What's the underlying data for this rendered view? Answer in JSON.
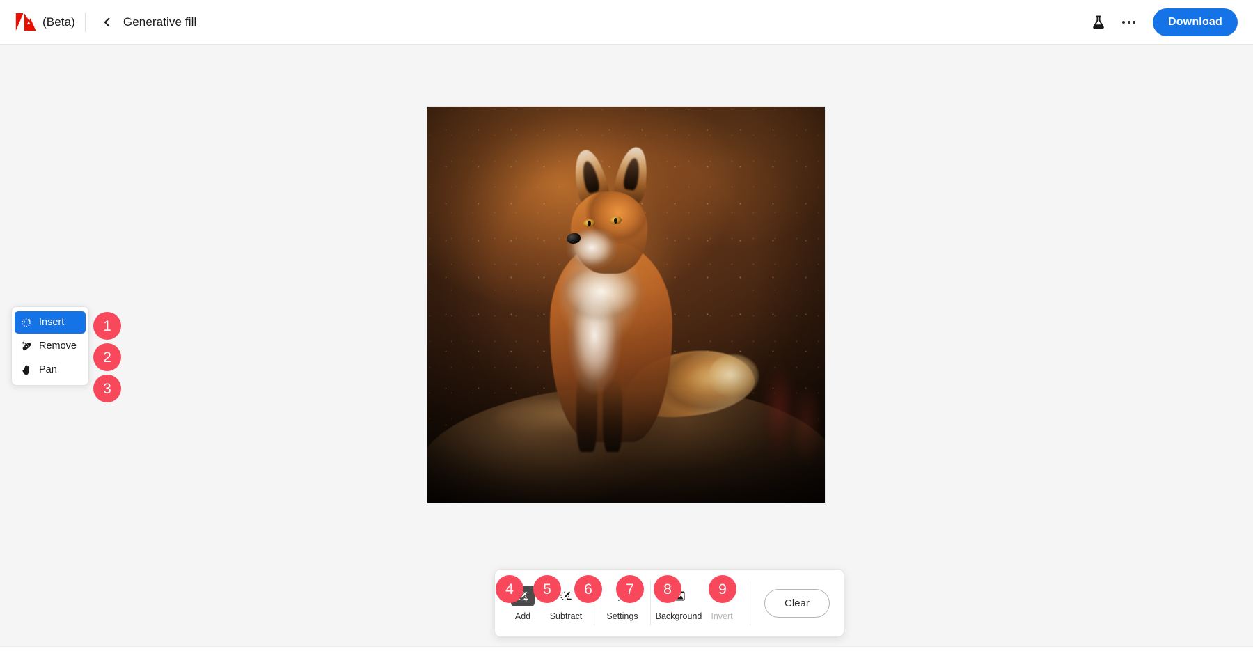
{
  "app": {
    "brand_logo": "adobe-logo",
    "beta_label": "(Beta)",
    "page_title": "Generative fill"
  },
  "header": {
    "back_icon": "chevron-left-icon",
    "experiments_icon": "flask-icon",
    "more_icon": "more-options-icon",
    "download_label": "Download",
    "accent_color": "#1473e6"
  },
  "tool_panel": {
    "items": [
      {
        "label": "Insert",
        "icon": "magic-wand-sparkle-icon",
        "selected": true,
        "badge": "1"
      },
      {
        "label": "Remove",
        "icon": "bandage-heal-icon",
        "selected": false,
        "badge": "2"
      },
      {
        "label": "Pan",
        "icon": "hand-pan-icon",
        "selected": false,
        "badge": "3"
      }
    ]
  },
  "toolbar": {
    "buttons": [
      {
        "label": "Add",
        "icon": "brush-add-icon",
        "state": "active",
        "badge": "4"
      },
      {
        "label": "Subtract",
        "icon": "brush-subtract-icon",
        "state": "normal",
        "badge": "5"
      },
      {
        "label": "Settings",
        "icon": "paintbrush-icon",
        "state": "normal",
        "badge": "6"
      },
      {
        "label": "Background",
        "icon": "image-mountain-icon",
        "state": "normal",
        "badge": "7"
      },
      {
        "label": "Invert",
        "icon": "invert-selection-icon",
        "state": "disabled",
        "badge": "8"
      }
    ],
    "clear_label": "Clear",
    "clear_badge": "9"
  },
  "canvas": {
    "artwork_description": "fox-photo",
    "badge_color": "#f8485c"
  }
}
